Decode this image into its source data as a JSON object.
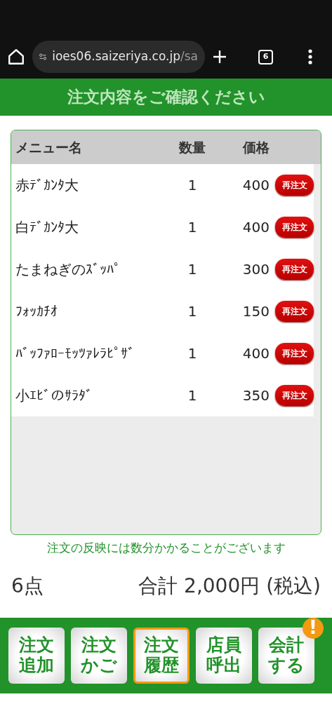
{
  "browser": {
    "url_host": "ioes06.saizeriya.co.jp",
    "url_path": "/sa",
    "tab_count": "6"
  },
  "header": {
    "title": "注文内容をご確認ください"
  },
  "table": {
    "columns": [
      "メニュー名",
      "数量",
      "価格"
    ],
    "rows": [
      {
        "name": "赤ﾃﾞｶﾝﾀ大",
        "qty": "1",
        "price": "400",
        "action": "再注文"
      },
      {
        "name": "白ﾃﾞｶﾝﾀ大",
        "qty": "1",
        "price": "400",
        "action": "再注文"
      },
      {
        "name": "たまねぎのｽﾞｯﾊﾟ",
        "qty": "1",
        "price": "300",
        "action": "再注文"
      },
      {
        "name": "ﾌｫｯｶﾁｵ",
        "qty": "1",
        "price": "150",
        "action": "再注文"
      },
      {
        "name": "ﾊﾞｯﾌｧﾛｰﾓｯﾂｧﾚﾗﾋﾟｻﾞ",
        "qty": "1",
        "price": "400",
        "action": "再注文"
      },
      {
        "name": "小ｴﾋﾞのｻﾗﾀﾞ",
        "qty": "1",
        "price": "350",
        "action": "再注文"
      }
    ]
  },
  "note": "注文の反映には数分かかることがございます",
  "summary": {
    "count": "6点",
    "total": "合計 2,000円 (税込)"
  },
  "nav": [
    {
      "label": "注文追加",
      "selected": false
    },
    {
      "label": "注文かご",
      "selected": false
    },
    {
      "label": "注文履歴",
      "selected": true
    },
    {
      "label": "店員呼出",
      "selected": false
    },
    {
      "label": "会計する",
      "selected": false,
      "badge": "!"
    }
  ]
}
